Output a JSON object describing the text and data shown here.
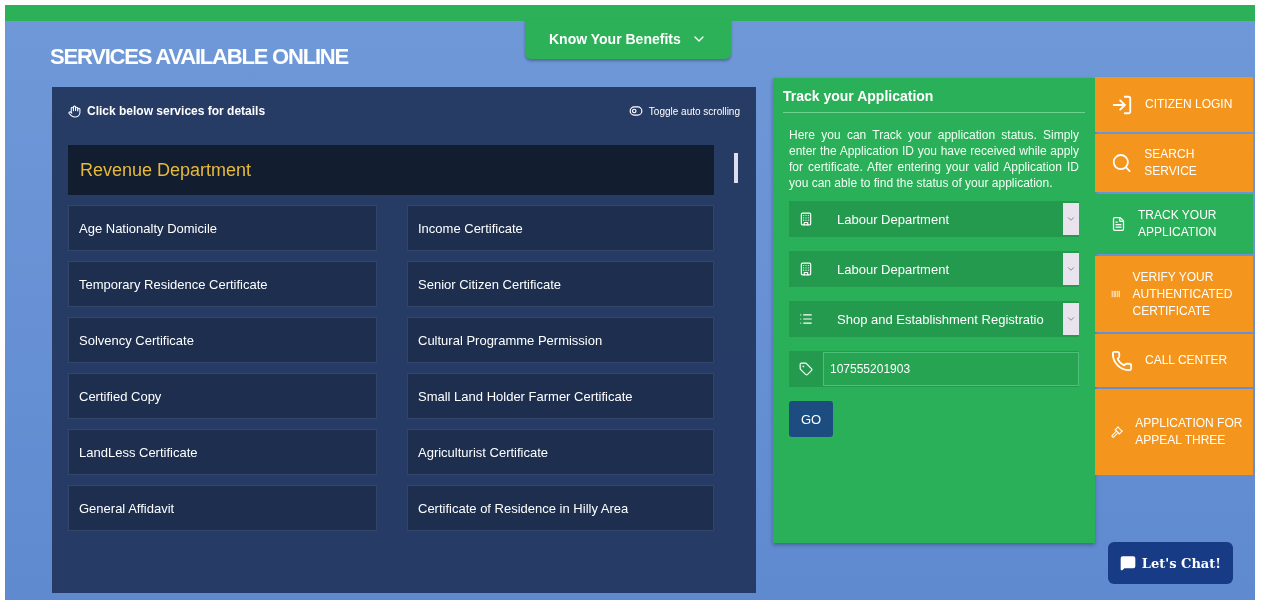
{
  "benefits_button": {
    "label": "Know Your Benefits"
  },
  "title": "SERVICES AVAILABLE ONLINE",
  "services": {
    "hint": "Click below services for details",
    "toggle": {
      "label": "Toggle auto scrolling",
      "on": false
    },
    "department": "Revenue Department",
    "items": [
      "Age Nationalty Domicile",
      "Income Certificate",
      "Temporary Residence Certificate",
      "Senior Citizen Certificate",
      "Solvency Certificate",
      "Cultural Programme Permission",
      "Certified Copy",
      "Small Land Holder Farmer Certificate",
      "LandLess Certificate",
      "Agriculturist Certificate",
      "General Affidavit",
      "Certificate of Residence in Hilly Area"
    ]
  },
  "track": {
    "title": "Track your Application",
    "description": "Here you can Track your application status. Simply enter the Application ID you have received while apply for certificate. After entering your valid Application ID you can able to find the status of your application.",
    "selects": [
      {
        "kind": "building",
        "value": "Labour Department"
      },
      {
        "kind": "building",
        "value": "Labour Department"
      },
      {
        "kind": "list",
        "value": "Shop and Establishment Registratio"
      }
    ],
    "application_id": "107555201903",
    "go": "GO"
  },
  "menu": [
    {
      "kind": "login",
      "label": "CITIZEN LOGIN",
      "selected": false
    },
    {
      "kind": "search",
      "label": "SEARCH SERVICE",
      "selected": false
    },
    {
      "kind": "document",
      "label": "TRACK YOUR APPLICATION",
      "selected": true
    },
    {
      "kind": "barcode",
      "label": "VERIFY YOUR AUTHENTICATED CERTIFICATE",
      "selected": false
    },
    {
      "kind": "phone",
      "label": "CALL CENTER",
      "selected": false
    },
    {
      "kind": "gavel",
      "label": "APPLICATION FOR APPEAL THREE",
      "selected": false
    }
  ],
  "chat_button": "Let's Chat!"
}
